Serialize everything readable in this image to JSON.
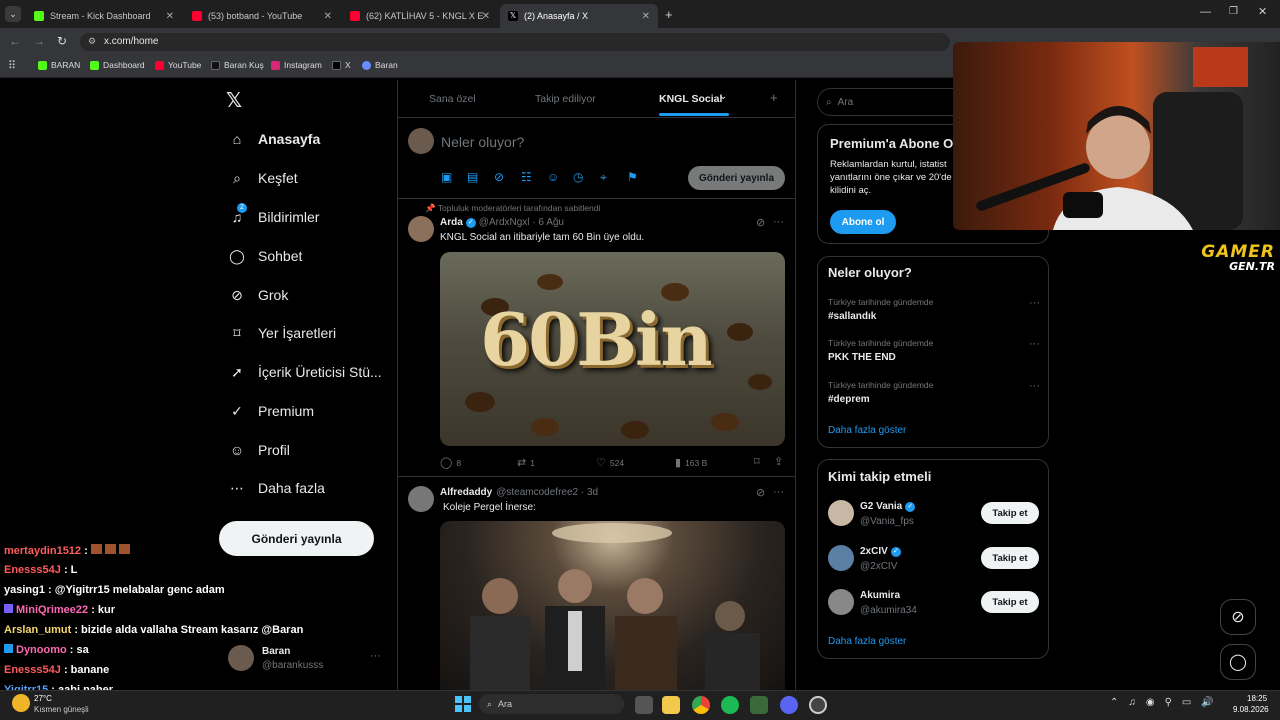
{
  "browser": {
    "tabs": [
      {
        "title": "Stream - Kick Dashboard",
        "color": "#53fc18"
      },
      {
        "title": "(53) botband - YouTube",
        "color": "#ff0033"
      },
      {
        "title": "(62) KATLİHAV 5 - KNGL X ERA",
        "color": "#ff0033"
      },
      {
        "title": "(2) Anasayfa / X",
        "color": "#ffffff"
      }
    ],
    "url": "x.com/home",
    "bookmarks": [
      "BARAN",
      "Dashboard",
      "YouTube",
      "Baran Kuş",
      "Instagram",
      "X",
      "Baran"
    ]
  },
  "sidebar": {
    "nav": [
      {
        "label": "Anasayfa",
        "icon": "home-icon",
        "glyph": "⌂"
      },
      {
        "label": "Keşfet",
        "icon": "search-icon",
        "glyph": "⌕"
      },
      {
        "label": "Bildirimler",
        "icon": "bell-icon",
        "glyph": "🔔",
        "badge": "2"
      },
      {
        "label": "Sohbet",
        "icon": "chat-icon",
        "glyph": "◯"
      },
      {
        "label": "Grok",
        "icon": "grok-icon",
        "glyph": "⊘"
      },
      {
        "label": "Yer İşaretleri",
        "icon": "bookmark-icon",
        "glyph": "⌑"
      },
      {
        "label": "İçerik Üreticisi Stü...",
        "icon": "rocket-icon",
        "glyph": "➚"
      },
      {
        "label": "Premium",
        "icon": "verified-icon",
        "glyph": "✓"
      },
      {
        "label": "Profil",
        "icon": "person-icon",
        "glyph": "☺"
      },
      {
        "label": "Daha fazla",
        "icon": "more-circle-icon",
        "glyph": "⋯"
      }
    ],
    "post_button": "Gönderi yayınla",
    "account": {
      "name": "Baran",
      "handle": "@barankusss"
    }
  },
  "feed": {
    "tabs": [
      "Sana özel",
      "Takip ediliyor",
      "KNGL Social"
    ],
    "compose_placeholder": "Neler oluyor?",
    "compose_button": "Gönderi yayınla",
    "posts": [
      {
        "pinned_label": "Topluluk moderatörleri tarafından sabitlendi",
        "name": "Arda",
        "handle": "@ArdxNgxl · 6 Ağu",
        "text": "KNGL Social an itibariyle tam 60 Bin üye oldu.",
        "image_text": "60Bin",
        "replies": "8",
        "reposts": "1",
        "likes": "524",
        "views": "163 B"
      },
      {
        "name": "Alfredaddy",
        "handle": "@steamcodefree2 · 3d",
        "text": "Koleje Pergel İnerse:"
      }
    ]
  },
  "right": {
    "search_placeholder": "Ara",
    "premium": {
      "title": "Premium'a Abone O",
      "text": "Reklamlardan kurtul, istatist yanıtlarını öne çıkar ve 20'de kilidini aç.",
      "button": "Abone ol"
    },
    "trends": {
      "title": "Neler oluyor?",
      "items": [
        {
          "meta": "Türkiye tarihinde gündemde",
          "name": "#sallandık"
        },
        {
          "meta": "Türkiye tarihinde gündemde",
          "name": "PKK THE END"
        },
        {
          "meta": "Türkiye tarihinde gündemde",
          "name": "#deprem"
        }
      ],
      "more": "Daha fazla göster"
    },
    "who_to_follow": {
      "title": "Kimi takip etmeli",
      "users": [
        {
          "name": "G2 Vania",
          "handle": "@Vania_fps",
          "button": "Takip et"
        },
        {
          "name": "2xCIV",
          "handle": "@2xCIV",
          "button": "Takip et"
        },
        {
          "name": "Akumira",
          "handle": "@akumira34",
          "button": "Takip et"
        }
      ],
      "more": "Daha fazla göster"
    }
  },
  "overlay": {
    "logo_line1": "GAMER",
    "logo_line2": "GEN.TR",
    "chat": [
      {
        "user": "mertaydin1512",
        "msg": "",
        "color": "#ff5c5c"
      },
      {
        "user": "Enesss54J",
        "msg": ": L",
        "color": "#ff5c5c"
      },
      {
        "user": "yasing1",
        "msg": ": @Yigitrr15 melabalar genc adam",
        "color": "#ffffff"
      },
      {
        "user": "MiniQrimee22",
        "msg": ": kur",
        "color": "#ff69b4"
      },
      {
        "user": "Arslan_umut",
        "msg": ": bizide alda vallaha Stream kasarız @Baran",
        "color": "#f5d76e"
      },
      {
        "user": "Dynoomo",
        "msg": ": sa",
        "color": "#ff69b4"
      },
      {
        "user": "Enesss54J",
        "msg": ": banane",
        "color": "#ff5c5c"
      },
      {
        "user": "Yigitrr15",
        "msg": ": aabi naber",
        "color": "#5aa0ff"
      }
    ]
  },
  "taskbar": {
    "weather_temp": "27°C",
    "weather_text": "Kısmen güneşli",
    "search": "Ara",
    "time": "18:25",
    "date": "9.08.2026"
  }
}
